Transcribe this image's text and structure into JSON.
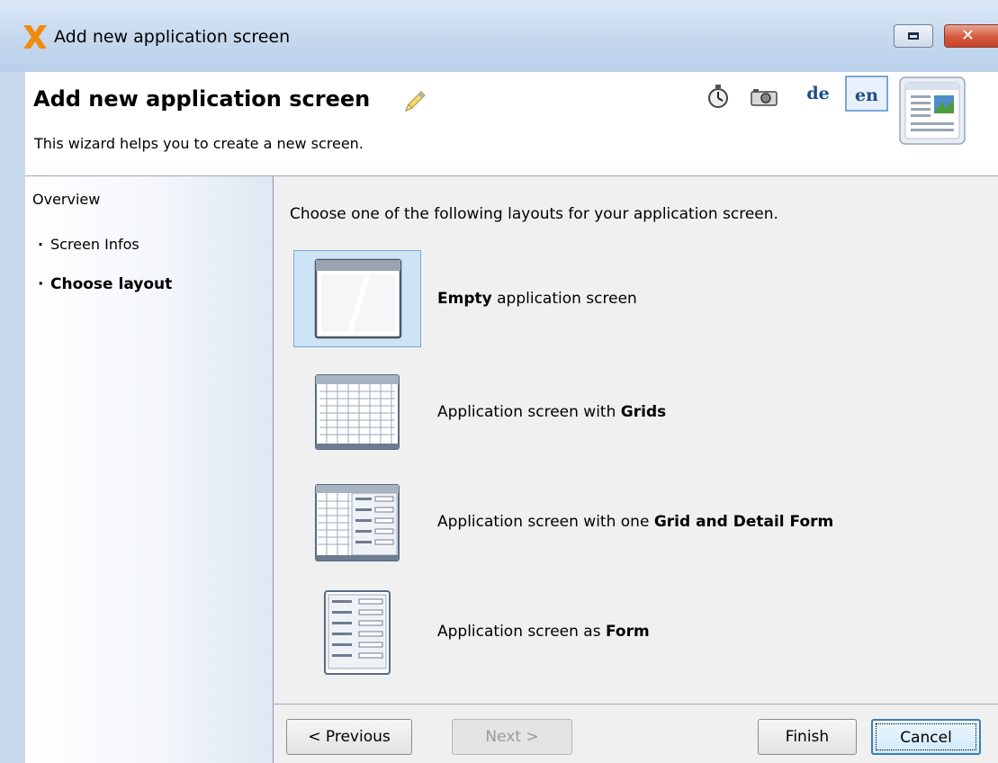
{
  "window": {
    "title": "Add new application screen",
    "close_glyph": "✕",
    "icons": [
      "app-x-logo-icon",
      "restore-icon",
      "close-icon"
    ]
  },
  "header": {
    "title": "Add new application screen",
    "subtitle": "This wizard helps you to create a new screen.",
    "lang_de": "de",
    "lang_en": "en",
    "selected_lang": "en",
    "icons": [
      "pencil-icon",
      "stopwatch-icon",
      "camera-icon",
      "screen-wizard-icon"
    ]
  },
  "sidebar": {
    "overview": "Overview",
    "bullet": "·",
    "items": [
      {
        "label": "Screen Infos",
        "active": false
      },
      {
        "label": "Choose layout",
        "active": true
      }
    ]
  },
  "main": {
    "instruction": "Choose one of the following layouts for your application screen.",
    "options": [
      {
        "bold": "Empty",
        "text": " application screen",
        "bold_first": true,
        "selected": true,
        "icon": "empty-screen-icon"
      },
      {
        "prefix": "Application screen with ",
        "bold": "Grids",
        "selected": false,
        "icon": "grids-icon"
      },
      {
        "prefix": "Application screen with one ",
        "bold": "Grid and Detail Form",
        "selected": false,
        "icon": "grid-detail-form-icon"
      },
      {
        "prefix": "Application screen as ",
        "bold": "Form",
        "selected": false,
        "icon": "form-icon"
      }
    ]
  },
  "buttons": {
    "previous": "< Previous",
    "next": "Next >",
    "finish": "Finish",
    "cancel": "Cancel",
    "next_enabled": false
  },
  "colors": {
    "titlebar": "#c5d8ee",
    "selection": "#cde4f7",
    "lang_text": "#1e4e88",
    "close_button": "#d35a3d"
  }
}
